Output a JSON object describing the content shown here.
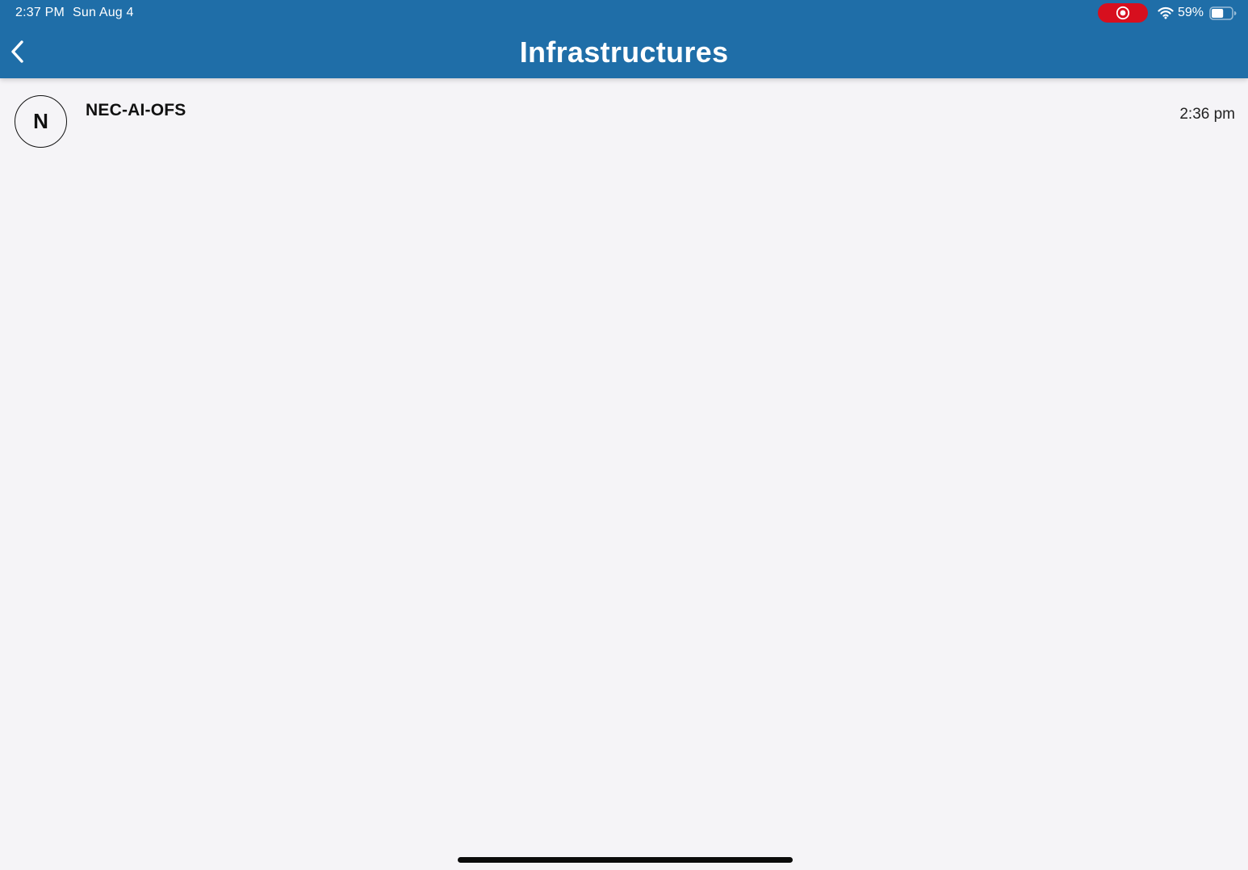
{
  "status_bar": {
    "time": "2:37 PM",
    "date": "Sun Aug 4",
    "battery_percent": "59%",
    "battery_level": 0.59,
    "screen_recording": true,
    "icons": [
      "record-icon",
      "wifi-icon",
      "battery-icon"
    ]
  },
  "nav": {
    "title": "Infrastructures",
    "back_icon": "chevron-left-icon"
  },
  "list": {
    "items": [
      {
        "avatar_letter": "N",
        "name": "NEC-AI-OFS",
        "time": "2:36 pm"
      }
    ]
  },
  "colors": {
    "header_bg": "#1f6ea8",
    "page_bg": "#f5f4f7",
    "record_pill": "#d70f1e",
    "text_primary": "#111111"
  }
}
